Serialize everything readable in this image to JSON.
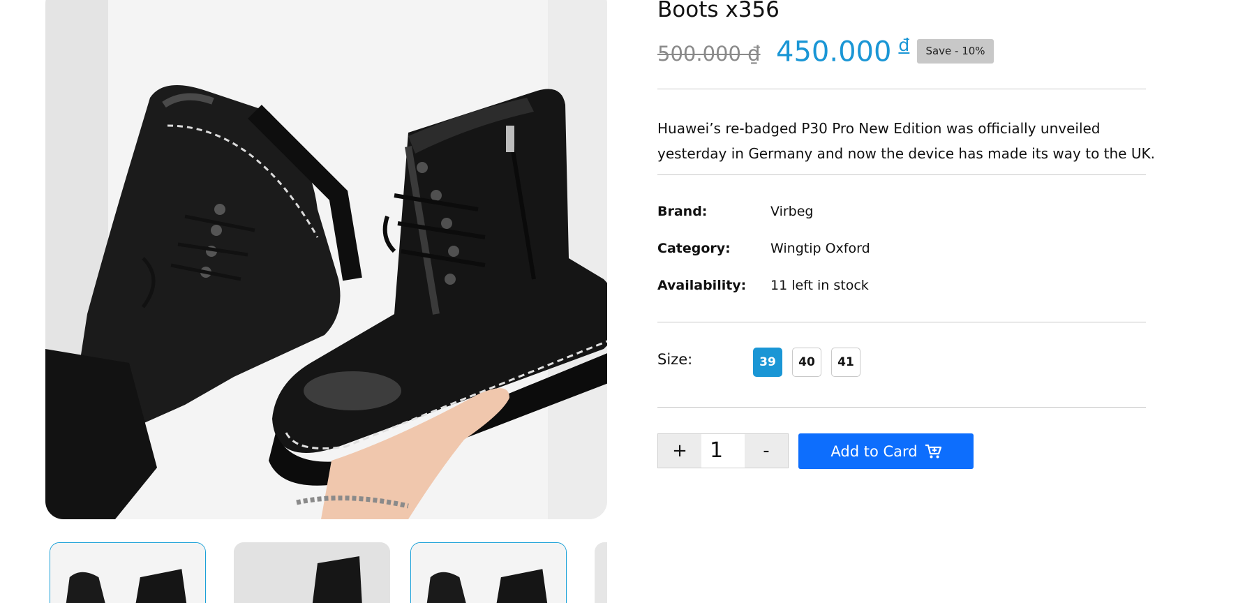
{
  "product": {
    "title": "Boots x356",
    "old_price": "500.000 ₫",
    "new_price": "450.000",
    "currency": "đ",
    "save_badge": "Save - 10%",
    "description": "Huawei’s re-badged P30 Pro New Edition was officially unveiled yesterday in Germany and now the device has made its way to the UK.",
    "specs": [
      {
        "label": "Brand:",
        "value": "Virbeg"
      },
      {
        "label": "Category:",
        "value": "Wingtip Oxford"
      },
      {
        "label": "Availability:",
        "value": "11 left in stock"
      }
    ],
    "size_label": "Size:",
    "sizes": [
      "39",
      "40",
      "41"
    ],
    "selected_size": "39"
  },
  "cart": {
    "plus": "+",
    "quantity": "1",
    "minus": "-",
    "add_label": "Add to Card",
    "add_icon": "cart-plus-icon"
  },
  "gallery": {
    "main_image": "black leather lace-up boots held in hand",
    "thumbnails": [
      {
        "selected": true
      },
      {
        "selected": false
      },
      {
        "selected": true
      },
      {
        "selected": false
      }
    ]
  },
  "colors": {
    "accent_blue": "#1a96d5",
    "button_blue": "#0d6efd",
    "badge_gray": "#c8c8c8"
  }
}
